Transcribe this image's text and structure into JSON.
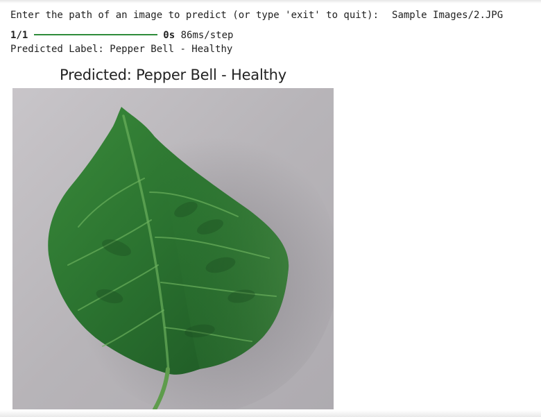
{
  "console": {
    "prompt": "Enter the path of an image to predict (or type 'exit' to quit):",
    "input_value": "Sample Images/2.JPG",
    "progress_step": "1/1",
    "progress_time": "0s",
    "progress_rate": "86ms/step",
    "result_label": "Predicted Label:",
    "result_value": "Pepper Bell - Healthy"
  },
  "figure": {
    "title": "Predicted: Pepper Bell - Healthy",
    "image_subject": "pepper-bell-leaf"
  },
  "colors": {
    "progress_bar": "#2e8b3a",
    "leaf_dark": "#1f5b24",
    "leaf_mid": "#2f7a33",
    "leaf_light": "#4f9a4a",
    "background_paper": "#b9b6ba"
  }
}
